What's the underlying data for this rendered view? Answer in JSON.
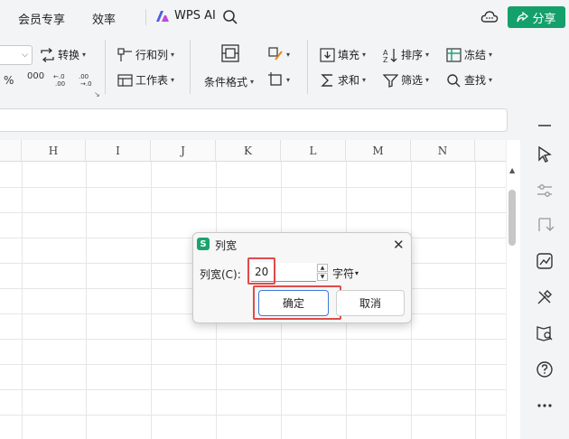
{
  "menu": {
    "member_label": "会员专享",
    "efficiency_label": "效率",
    "wps_ai_label": "WPS AI",
    "share_label": "分享"
  },
  "ribbon": {
    "convert_label": "转换",
    "row_col_label": "行和列",
    "worksheet_label": "工作表",
    "cond_format_label": "条件格式",
    "fill_label": "填充",
    "sort_label": "排序",
    "freeze_label": "冻结",
    "sum_label": "求和",
    "filter_label": "筛选",
    "find_label": "查找",
    "percent_symbol": "%",
    "thousands_symbol": "000",
    "caret": "▾"
  },
  "sheet": {
    "columns": [
      "H",
      "I",
      "J",
      "K",
      "L",
      "M",
      "N"
    ]
  },
  "dialog": {
    "logo": "S",
    "title": "列宽",
    "close": "✕",
    "field_label": "列宽(C):",
    "value": "20",
    "unit": "字符",
    "unit_caret": "▾",
    "spin_up": "▲",
    "spin_down": "▼",
    "ok_label": "确定",
    "cancel_label": "取消"
  },
  "colors": {
    "accent": "#14a06b",
    "highlight": "#e04a4a",
    "focus": "#3a7bd5"
  }
}
